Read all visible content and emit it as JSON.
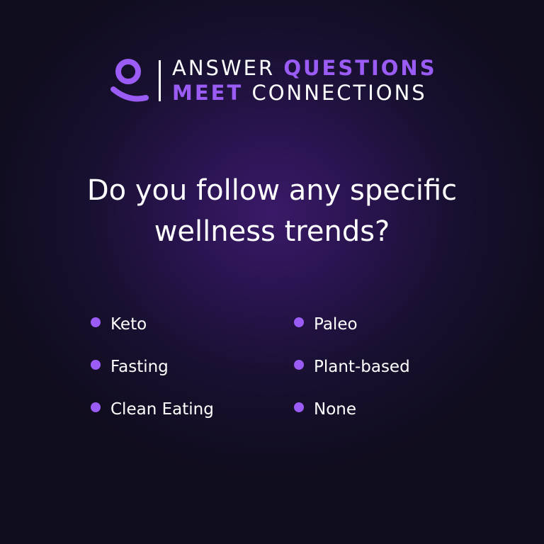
{
  "colors": {
    "accent": "#9b5cf5",
    "text": "#ffffff",
    "background": "#1a1030"
  },
  "brand": {
    "logo_icon": "user-icon",
    "line1": {
      "word1": "ANSWER",
      "word2": "QUESTIONS"
    },
    "line2": {
      "word1": "MEET",
      "word2": "CONNECTIONS"
    }
  },
  "question": {
    "line1": "Do you follow any specific",
    "line2": "wellness trends?"
  },
  "options": [
    {
      "label": "Keto"
    },
    {
      "label": "Paleo"
    },
    {
      "label": "Fasting"
    },
    {
      "label": "Plant-based"
    },
    {
      "label": "Clean Eating"
    },
    {
      "label": "None"
    }
  ]
}
